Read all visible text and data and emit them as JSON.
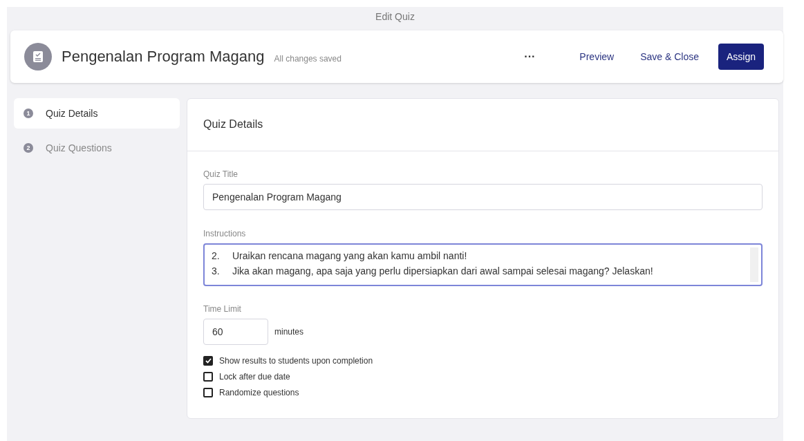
{
  "page_title": "Edit Quiz",
  "header": {
    "title": "Pengenalan Program Magang",
    "status": "All changes saved",
    "more": "···",
    "actions": [
      {
        "label": "Preview",
        "kind": "link"
      },
      {
        "label": "Save & Close",
        "kind": "link"
      },
      {
        "label": "Assign",
        "kind": "primary"
      }
    ]
  },
  "steps": [
    {
      "number": "1",
      "label": "Quiz Details",
      "selected": true
    },
    {
      "number": "2",
      "label": "Quiz Questions",
      "selected": false
    }
  ],
  "panel": {
    "title": "Quiz Details",
    "quiz_title": {
      "label": "Quiz Title",
      "value": "Pengenalan Program Magang"
    },
    "instructions": {
      "label": "Instructions",
      "lines": [
        {
          "number": "2.",
          "text": "Uraikan rencana magang yang akan kamu ambil nanti!"
        },
        {
          "number": "3.",
          "text": "Jika akan magang, apa saja yang perlu dipersiapkan dari awal sampai selesai magang? Jelaskan!"
        }
      ]
    },
    "time_limit": {
      "label": "Time Limit",
      "value": "60",
      "unit": "minutes"
    },
    "options": [
      {
        "label": "Show results to students upon completion",
        "checked": true
      },
      {
        "label": "Lock after due date",
        "checked": false
      },
      {
        "label": "Randomize questions",
        "checked": false
      }
    ]
  }
}
